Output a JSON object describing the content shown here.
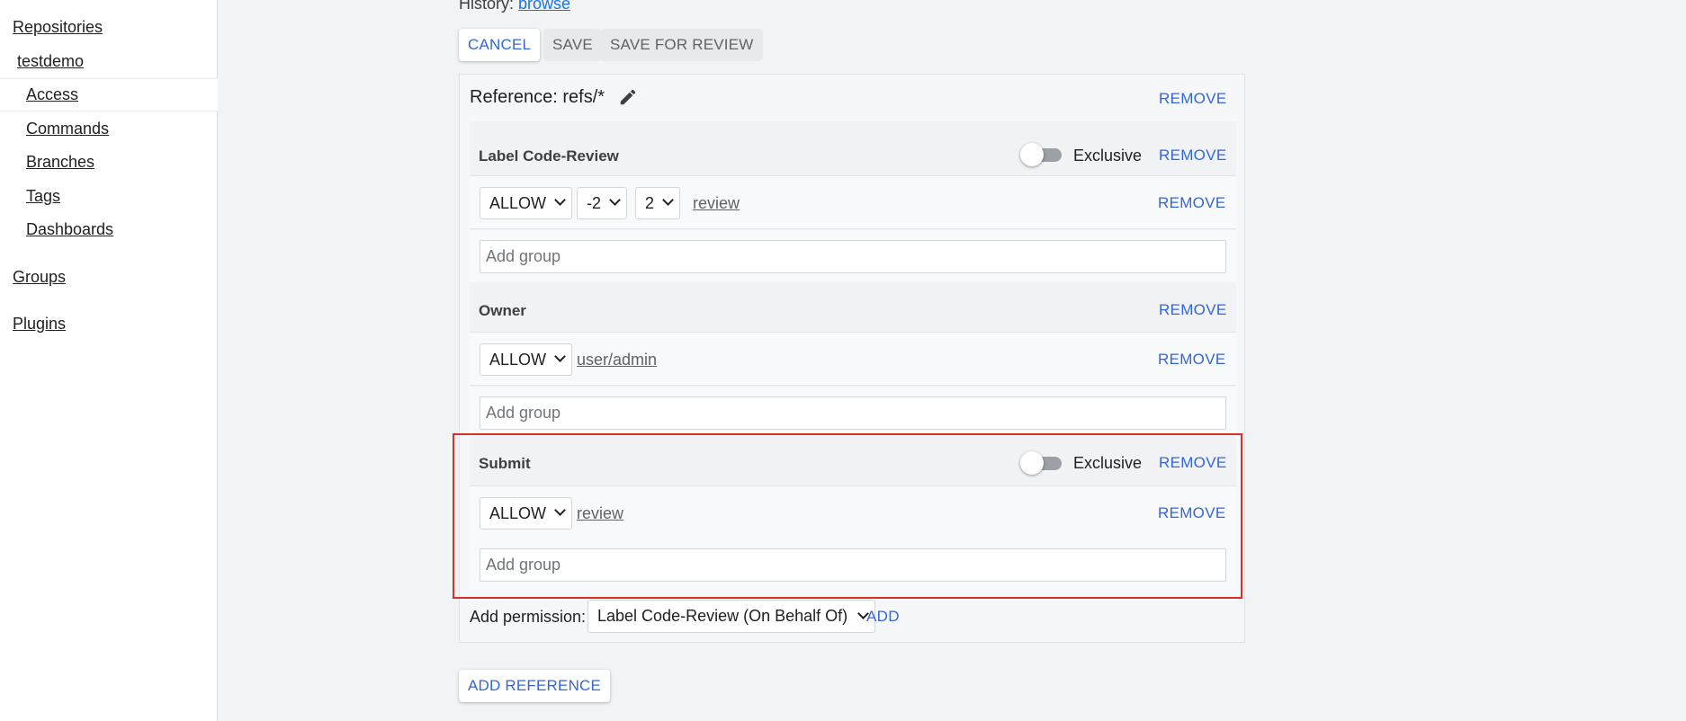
{
  "sidebar": {
    "repositories": "Repositories",
    "repo_name": "testdemo",
    "items": [
      {
        "label": "Access"
      },
      {
        "label": "Commands"
      },
      {
        "label": "Branches"
      },
      {
        "label": "Tags"
      },
      {
        "label": "Dashboards"
      }
    ],
    "groups": "Groups",
    "plugins": "Plugins"
  },
  "header": {
    "history_label": "History:",
    "history_link": "browse"
  },
  "toolbar": {
    "cancel_label": "CANCEL",
    "save_label": "SAVE",
    "save_for_review_label": "SAVE FOR REVIEW"
  },
  "reference": {
    "title": "Reference: refs/*",
    "remove_label": "REMOVE",
    "permissions": [
      {
        "title": "Label Code-Review",
        "exclusive_label": "Exclusive",
        "exclusive_on": false,
        "remove_label": "REMOVE",
        "rule": {
          "action": "ALLOW",
          "min": "-2",
          "max": "2",
          "group": "review",
          "remove_label": "REMOVE"
        },
        "add_group_placeholder": "Add group"
      },
      {
        "title": "Owner",
        "remove_label": "REMOVE",
        "rule": {
          "action": "ALLOW",
          "group": "user/admin",
          "remove_label": "REMOVE"
        },
        "add_group_placeholder": "Add group"
      },
      {
        "title": "Submit",
        "exclusive_label": "Exclusive",
        "exclusive_on": false,
        "remove_label": "REMOVE",
        "rule": {
          "action": "ALLOW",
          "group": "review",
          "remove_label": "REMOVE"
        },
        "add_group_placeholder": "Add group"
      }
    ],
    "add_permission": {
      "label": "Add permission:",
      "selected": "Label Code-Review (On Behalf Of)",
      "add_label": "ADD"
    }
  },
  "footer": {
    "add_reference_label": "ADD REFERENCE"
  },
  "colors": {
    "accent": "#3367d6",
    "highlight": "#d93025"
  },
  "icons": {
    "edit": "pencil-icon",
    "dropdown": "chevron-down-icon"
  }
}
